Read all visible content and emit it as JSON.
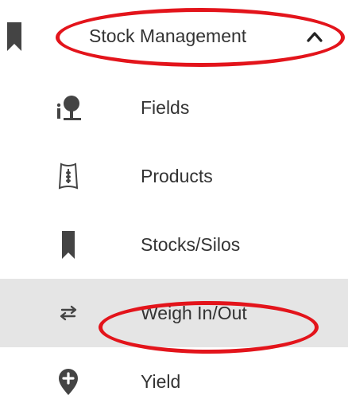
{
  "colors": {
    "icon": "#444444",
    "text": "#333333",
    "active_bg": "#e5e5e5",
    "annotation": "#e3141b"
  },
  "menu": {
    "header": {
      "label": "Stock Management",
      "icon": "bookmark-icon",
      "expanded": true
    },
    "items": [
      {
        "label": "Fields",
        "icon": "field-tree-icon",
        "active": false
      },
      {
        "label": "Products",
        "icon": "product-bag-icon",
        "active": false
      },
      {
        "label": "Stocks/Silos",
        "icon": "bookmark-icon",
        "active": false
      },
      {
        "label": "Weigh In/Out",
        "icon": "swap-arrows-icon",
        "active": true
      },
      {
        "label": "Yield",
        "icon": "map-pin-plus-icon",
        "active": false
      }
    ]
  }
}
